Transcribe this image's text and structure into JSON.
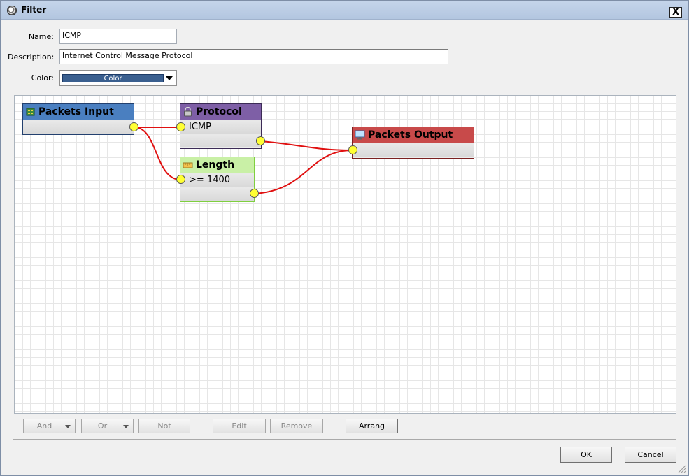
{
  "window": {
    "title": "Filter",
    "close_label": "X"
  },
  "form": {
    "name_label": "Name:",
    "name_value": "ICMP",
    "description_label": "Description:",
    "description_value": "Internet Control Message Protocol",
    "color_label": "Color:",
    "color_value": "Color",
    "color_hex": "#3a5f8f"
  },
  "nodes": {
    "packets_input": {
      "title": "Packets Input",
      "color": "#4a7fc0",
      "icon": "chip-icon"
    },
    "protocol": {
      "title": "Protocol",
      "value": "ICMP",
      "color": "#7e5fa6",
      "icon": "lock-icon"
    },
    "length": {
      "title": "Length",
      "value": ">= 1400",
      "color": "#c9f0a6",
      "icon": "ruler-icon"
    },
    "packets_output": {
      "title": "Packets Output",
      "color": "#c84a4a",
      "icon": "monitor-icon"
    }
  },
  "wire_color": "#e01010",
  "toolbar": {
    "and_label": "And",
    "or_label": "Or",
    "not_label": "Not",
    "edit_label": "Edit",
    "remove_label": "Remove",
    "arrange_label": "Arrang"
  },
  "footer": {
    "ok_label": "OK",
    "cancel_label": "Cancel"
  }
}
